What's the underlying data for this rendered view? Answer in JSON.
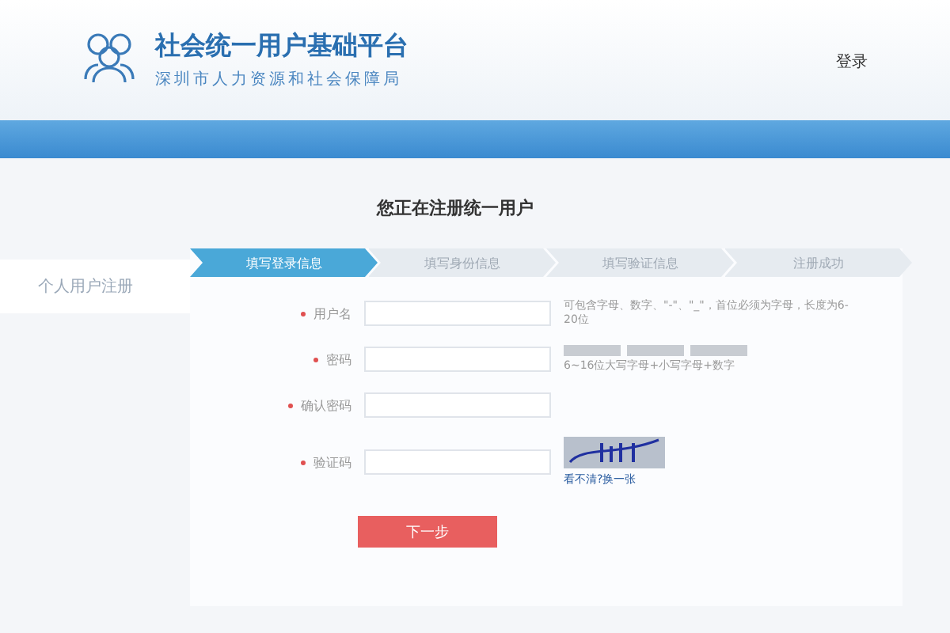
{
  "header": {
    "title": "社会统一用户基础平台",
    "subtitle": "深圳市人力资源和社会保障局",
    "login_link": "登录"
  },
  "sidebar": {
    "items": [
      {
        "label": "个人用户注册",
        "selected": true
      }
    ]
  },
  "heading": "您正在注册统一用户",
  "steps": [
    {
      "label": "填写登录信息",
      "selected": true
    },
    {
      "label": "填写身份信息",
      "selected": false
    },
    {
      "label": "填写验证信息",
      "selected": false
    },
    {
      "label": "注册成功",
      "selected": false
    }
  ],
  "fields": [
    {
      "kind": "text",
      "label": "用户名",
      "required": true,
      "hint": "可包含字母、数字、\"-\"、\"_\"，首位必须为字母，长度为6-20位"
    },
    {
      "kind": "password",
      "label": "密码",
      "required": true,
      "hint": "6~16位大写字母+小写字母+数字"
    },
    {
      "kind": "text",
      "label": "确认密码",
      "required": true
    },
    {
      "kind": "captcha",
      "label": "验证码",
      "required": true,
      "refresh_link": "看不清?换一张"
    }
  ],
  "submit_button": "下一步"
}
